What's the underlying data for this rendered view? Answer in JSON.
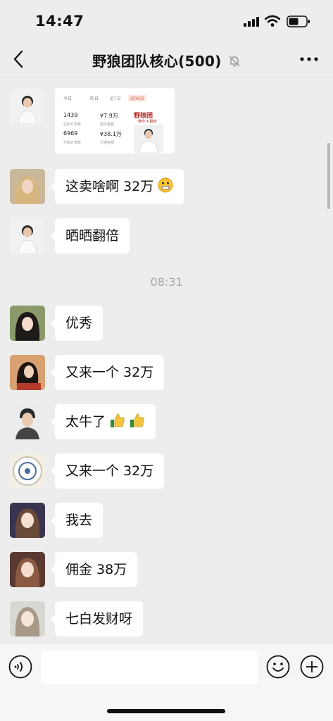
{
  "status_bar": {
    "time": "14:47"
  },
  "nav": {
    "title": "野狼团队核心(500)",
    "back_icon": "chevron-left-icon",
    "mute_icon": "bell-slash-icon",
    "more_icon": "ellipsis-icon"
  },
  "image_message": {
    "tabs": [
      "今日",
      "昨日",
      "近7日",
      "近30日"
    ],
    "stats": [
      {
        "value": "1439",
        "label": "拉新订单数"
      },
      {
        "value": "¥7.9万",
        "label": "成交金额"
      },
      {
        "value": "6969",
        "label": "付款订单数"
      },
      {
        "value": "¥38.1万",
        "label": "计佣金额"
      }
    ],
    "brand": "野狼团",
    "brand_sub": "带你飞·翻倍"
  },
  "messages": [
    {
      "text": "这卖啥啊 32万",
      "emoji": "grimace-emoji"
    },
    {
      "text": "晒晒翻倍"
    },
    {
      "text": "优秀"
    },
    {
      "text": "又来一个 32万"
    },
    {
      "text": "太牛了",
      "emoji": "thumbs-up-emoji"
    },
    {
      "text": "又来一个 32万"
    },
    {
      "text": "我去"
    },
    {
      "text": "佣金 38万"
    },
    {
      "text": "七白发财呀"
    }
  ],
  "time_divider": "08:31",
  "input_bar": {
    "placeholder": "",
    "voice_icon": "voice-icon",
    "emoji_icon": "smiley-icon",
    "plus_icon": "plus-circle-icon"
  },
  "colors": {
    "background": "#ededed",
    "bubble": "#ffffff",
    "accent_red": "#b3261e"
  }
}
